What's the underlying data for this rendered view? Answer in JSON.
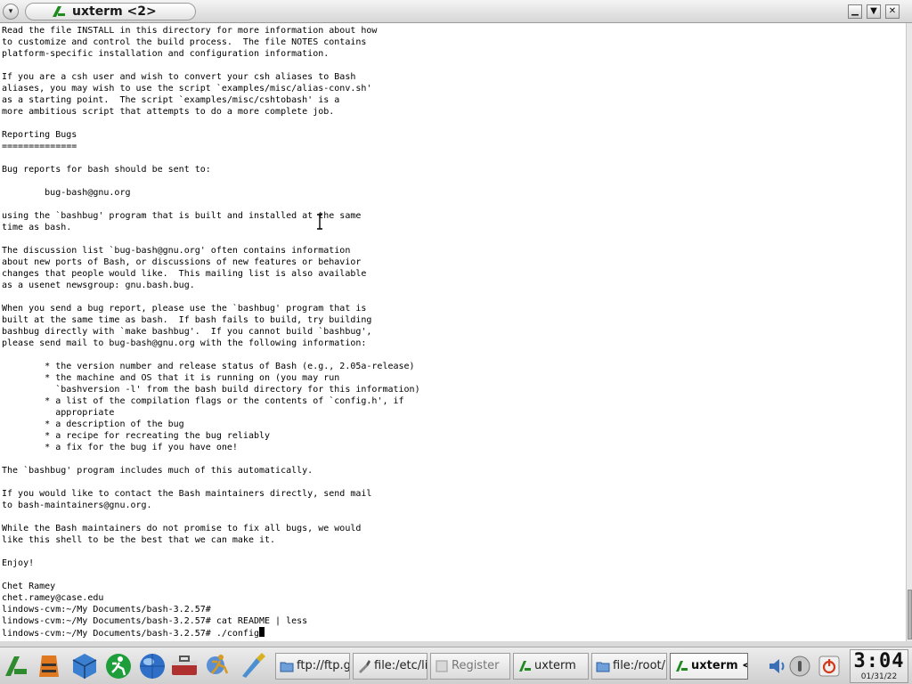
{
  "window": {
    "title": "uxterm <2>",
    "menu_glyph": "▾",
    "min_glyph": "▁",
    "max_glyph": "▼",
    "close_glyph": "✕"
  },
  "terminal": {
    "lines": [
      "Read the file INSTALL in this directory for more information about how",
      "to customize and control the build process.  The file NOTES contains",
      "platform-specific installation and configuration information.",
      "",
      "If you are a csh user and wish to convert your csh aliases to Bash",
      "aliases, you may wish to use the script `examples/misc/alias-conv.sh'",
      "as a starting point.  The script `examples/misc/cshtobash' is a",
      "more ambitious script that attempts to do a more complete job.",
      "",
      "Reporting Bugs",
      "==============",
      "",
      "Bug reports for bash should be sent to:",
      "",
      "        bug-bash@gnu.org",
      "",
      "using the `bashbug' program that is built and installed at the same",
      "time as bash.",
      "",
      "The discussion list `bug-bash@gnu.org' often contains information",
      "about new ports of Bash, or discussions of new features or behavior",
      "changes that people would like.  This mailing list is also available",
      "as a usenet newsgroup: gnu.bash.bug.",
      "",
      "When you send a bug report, please use the `bashbug' program that is",
      "built at the same time as bash.  If bash fails to build, try building",
      "bashbug directly with `make bashbug'.  If you cannot build `bashbug',",
      "please send mail to bug-bash@gnu.org with the following information:",
      "",
      "        * the version number and release status of Bash (e.g., 2.05a-release)",
      "        * the machine and OS that it is running on (you may run",
      "          `bashversion -l' from the bash build directory for this information)",
      "        * a list of the compilation flags or the contents of `config.h', if",
      "          appropriate",
      "        * a description of the bug",
      "        * a recipe for recreating the bug reliably",
      "        * a fix for the bug if you have one!",
      "",
      "The `bashbug' program includes much of this automatically.",
      "",
      "If you would like to contact the Bash maintainers directly, send mail",
      "to bash-maintainers@gnu.org.",
      "",
      "While the Bash maintainers do not promise to fix all bugs, we would",
      "like this shell to be the best that we can make it.",
      "",
      "Enjoy!",
      "",
      "Chet Ramey",
      "chet.ramey@case.edu",
      "lindows-cvm:~/My Documents/bash-3.2.57#",
      "lindows-cvm:~/My Documents/bash-3.2.57# cat README | less"
    ],
    "prompt_line": "lindows-cvm:~/My Documents/bash-3.2.57# ./config"
  },
  "taskbar": {
    "launchers": [
      {
        "name": "lindows-start-icon",
        "color": "#2e8b2e"
      },
      {
        "name": "life-vest-icon",
        "color": "#e07820"
      },
      {
        "name": "box-3d-icon",
        "color": "#3a7fd0"
      },
      {
        "name": "runner-green-icon",
        "color": "#1e9e3a"
      },
      {
        "name": "globe-browser-icon",
        "color": "#2f6fc8"
      },
      {
        "name": "toolbox-icon",
        "color": "#b03030"
      },
      {
        "name": "runner-figure-icon",
        "color": "#d89a20"
      },
      {
        "name": "paint-brush-icon",
        "color": "#4a90d0"
      }
    ],
    "tasks": [
      {
        "label": "ftp://ftp.gr",
        "icon": "folder-icon",
        "state": "normal"
      },
      {
        "label": "file:/etc/lir",
        "icon": "tool-icon",
        "state": "normal"
      },
      {
        "label": "Register",
        "icon": "register-icon",
        "state": "dim"
      },
      {
        "label": "uxterm",
        "icon": "terminal-icon",
        "state": "normal"
      },
      {
        "label": "file:/root/l",
        "icon": "folder-icon",
        "state": "normal"
      },
      {
        "label": "uxterm <",
        "icon": "terminal-icon",
        "state": "active"
      }
    ],
    "clock": {
      "time": "3:04",
      "date": "01/31/22"
    }
  }
}
